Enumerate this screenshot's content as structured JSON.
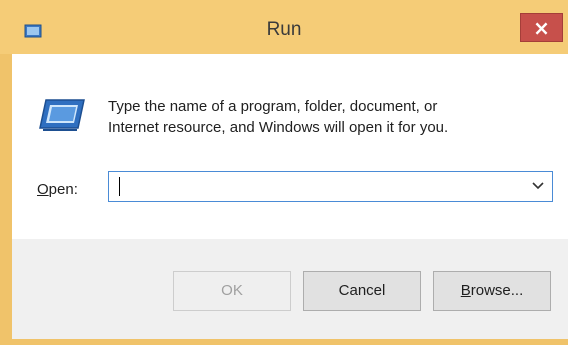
{
  "window": {
    "title": "Run",
    "close_label": "×",
    "accent_color": "#f5cc77",
    "close_color": "#c7504b"
  },
  "content": {
    "description_line1": "Type the name of a program, folder, document, or",
    "description_line2": "Internet resource, and Windows will open it for you.",
    "icon": "run-icon"
  },
  "open_field": {
    "label_mnemonic": "O",
    "label_rest": "pen:",
    "value": "",
    "dropdown_icon": "chevron-down-icon"
  },
  "buttons": {
    "ok_label": "OK",
    "ok_enabled": false,
    "cancel_label": "Cancel",
    "browse_mnemonic": "B",
    "browse_rest": "rowse..."
  }
}
